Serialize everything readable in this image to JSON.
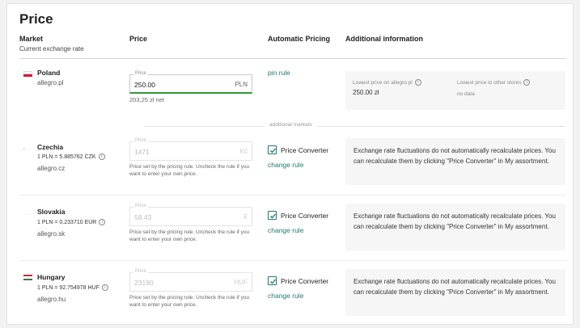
{
  "page": {
    "title": "Price"
  },
  "headers": {
    "market": "Market",
    "market_sub": "Current exchange rate",
    "price": "Price",
    "automatic_pricing": "Automatic Pricing",
    "additional_info": "Additional information"
  },
  "divider_label": "additional markets",
  "poland": {
    "country": "Poland",
    "domain": "allegro.pl",
    "price_legend": "Price",
    "price_value": "250.00",
    "currency": "PLN",
    "net": "203,25 zł net",
    "pin_rule": "pin rule",
    "lowest_label": "Lowest price on allegro.pl",
    "lowest_value": "250.00 zł",
    "other_label": "Lowest price in other stores",
    "other_value": "no data"
  },
  "czechia": {
    "country": "Czechia",
    "rate": "1 PLN = 5.885762 CZK",
    "domain": "allegro.cz",
    "price_legend": "Price",
    "price_value": "1471",
    "currency": "Kč",
    "help": "Price set by the pricing rule. Uncheck the rule if you want to enter your own price.",
    "converter_label": "Price Converter",
    "change_rule": "change rule",
    "info": "Exchange rate fluctuations do not automatically recalculate prices. You can recalculate them by clicking \"Price Converter\" in My assortment."
  },
  "slovakia": {
    "country": "Slovakia",
    "rate": "1 PLN = 0.233710 EUR",
    "domain": "allegro.sk",
    "price_legend": "Price",
    "price_value": "58.43",
    "currency": "€",
    "help": "Price set by the pricing rule. Uncheck the rule if you want to enter your own price.",
    "converter_label": "Price Converter",
    "change_rule": "change rule",
    "info": "Exchange rate fluctuations do not automatically recalculate prices. You can recalculate them by clicking \"Price Converter\" in My assortment."
  },
  "hungary": {
    "country": "Hungary",
    "rate": "1 PLN = 92.754978 HUF",
    "domain": "allegro.hu",
    "price_legend": "Price",
    "price_value": "23190",
    "currency": "HUF",
    "help": "Price set by the pricing rule. Uncheck the rule if you want to enter your own price.",
    "converter_label": "Price Converter",
    "change_rule": "change rule",
    "info": "Exchange rate fluctuations do not automatically recalculate prices. You can recalculate them by clicking \"Price Converter\" in My assortment."
  },
  "colors": {
    "accent": "#1f7a6e",
    "active_border": "#2e9a33"
  }
}
